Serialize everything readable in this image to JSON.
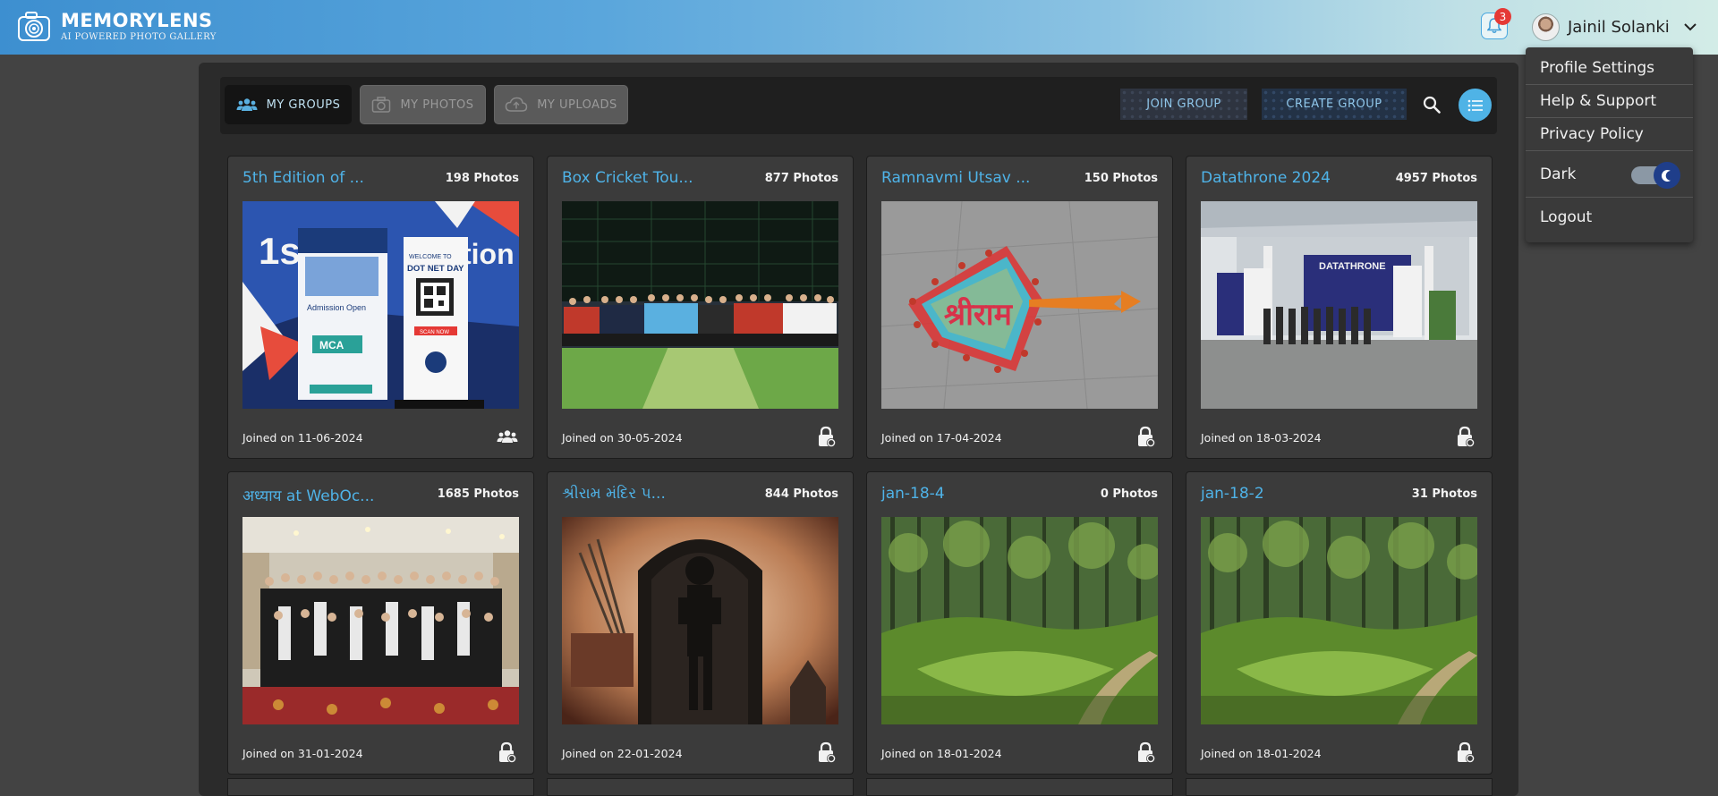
{
  "app": {
    "brand_title": "MEMORYLENS",
    "brand_subtitle": "AI POWERED PHOTO GALLERY"
  },
  "header": {
    "notification_count": "3",
    "user_name": "Jainil Solanki"
  },
  "user_menu": {
    "items": [
      "Profile Settings",
      "Help & Support",
      "Privacy Policy"
    ],
    "dark_label": "Dark",
    "dark_mode_on": true,
    "logout_label": "Logout"
  },
  "tabs": [
    {
      "label": "MY GROUPS",
      "active": true
    },
    {
      "label": "MY PHOTOS",
      "active": false
    },
    {
      "label": "MY UPLOADS",
      "active": false
    }
  ],
  "actions": {
    "join_group": "JOIN GROUP",
    "create_group": "CREATE GROUP"
  },
  "groups": [
    {
      "title": "5th Edition of ...",
      "photos": "198 Photos",
      "joined": "Joined on 11-06-2024",
      "access": "group"
    },
    {
      "title": "Box Cricket Tou...",
      "photos": "877 Photos",
      "joined": "Joined on 30-05-2024",
      "access": "private"
    },
    {
      "title": "Ramnavmi Utsav ...",
      "photos": "150 Photos",
      "joined": "Joined on 17-04-2024",
      "access": "private"
    },
    {
      "title": "Datathrone 2024",
      "photos": "4957 Photos",
      "joined": "Joined on 18-03-2024",
      "access": "private"
    },
    {
      "title": "अध्याय at WebOc...",
      "photos": "1685 Photos",
      "joined": "Joined on 31-01-2024",
      "access": "private"
    },
    {
      "title": "શ્રીરામ મંદિર પ...",
      "photos": "844 Photos",
      "joined": "Joined on 22-01-2024",
      "access": "private"
    },
    {
      "title": "jan-18-4",
      "photos": "0 Photos",
      "joined": "Joined on 18-01-2024",
      "access": "private"
    },
    {
      "title": "jan-18-2",
      "photos": "31 Photos",
      "joined": "Joined on 18-01-2024",
      "access": "private"
    }
  ],
  "image_text": {
    "banner_big": "1st",
    "banner_side": "tion",
    "banner_welcome": "WELCOME TO",
    "banner_dot_net": "DOT NET DAY",
    "banner_scan": "SCAN NOW",
    "banner_admission": "Admission Open",
    "banner_mca": "MCA",
    "datathrone_banner": "DATATHRONE",
    "rangoli_text": "श्रीराम"
  },
  "colors": {
    "accent": "#4fb3e8",
    "badge": "#e53935",
    "toggle_knob": "#1f3e8a"
  }
}
